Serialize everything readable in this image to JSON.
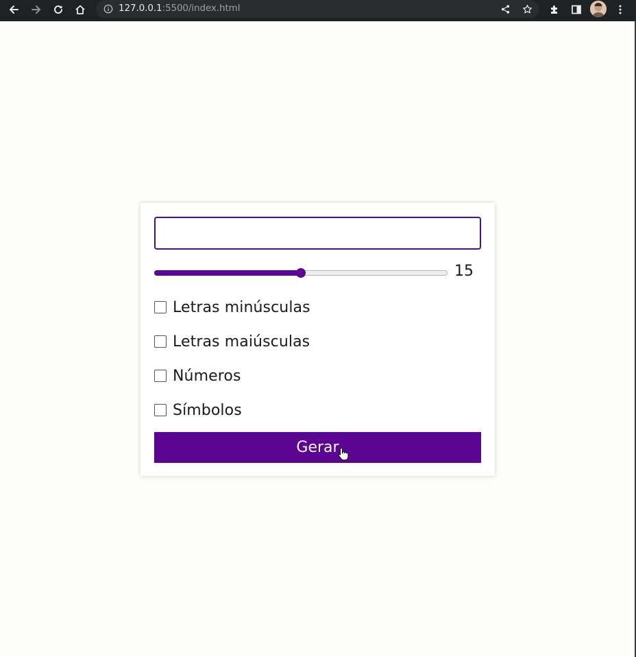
{
  "browser": {
    "url_host": "127.0.0.1",
    "url_rest": ":5500/index.html",
    "icons": [
      "back-icon",
      "forward-icon",
      "reload-icon",
      "home-icon",
      "info-icon",
      "share-icon",
      "star-icon",
      "extensions-icon",
      "side-panel-icon",
      "avatar",
      "more-icon"
    ]
  },
  "form": {
    "password_value": "",
    "length_value": "15",
    "length_fraction": 0.5,
    "options": [
      {
        "label": "Letras minúsculas",
        "checked": false
      },
      {
        "label": "Letras maiúsculas",
        "checked": false
      },
      {
        "label": "Números",
        "checked": false
      },
      {
        "label": "Símbolos",
        "checked": false
      }
    ],
    "generate_label": "Gerar"
  },
  "colors": {
    "accent": "#5c0593",
    "border": "#4b0f82",
    "background": "#fdfdfa",
    "toolbar": "#202124"
  }
}
